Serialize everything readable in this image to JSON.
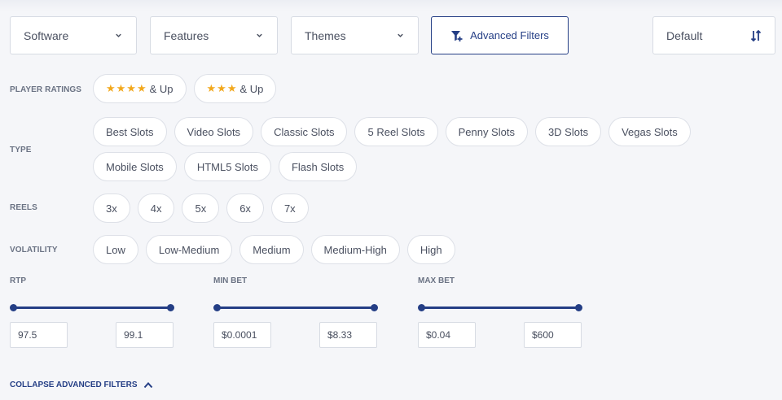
{
  "dropdowns": {
    "software": "Software",
    "features": "Features",
    "themes": "Themes"
  },
  "advanced_filters_label": "Advanced Filters",
  "sort": {
    "value": "Default",
    "icon": "sort-arrows-icon"
  },
  "filters": {
    "player_ratings": {
      "label": "PLAYER RATINGS",
      "options": [
        {
          "stars": "★★★★",
          "text": "& Up"
        },
        {
          "stars": "★★★",
          "text": "& Up"
        }
      ]
    },
    "type": {
      "label": "TYPE",
      "options_row1": [
        "Best Slots",
        "Video Slots",
        "Classic Slots",
        "5 Reel Slots",
        "Penny Slots",
        "3D Slots",
        "Vegas Slots"
      ],
      "options_row2": [
        "Mobile Slots",
        "HTML5 Slots",
        "Flash Slots"
      ]
    },
    "reels": {
      "label": "REELS",
      "options": [
        "3x",
        "4x",
        "5x",
        "6x",
        "7x"
      ]
    },
    "volatility": {
      "label": "VOLATILITY",
      "options": [
        "Low",
        "Low-Medium",
        "Medium",
        "Medium-High",
        "High"
      ]
    }
  },
  "ranges": {
    "rtp": {
      "label": "RTP",
      "min": "97.5",
      "max": "99.1"
    },
    "min_bet": {
      "label": "MIN BET",
      "min": "$0.0001",
      "max": "$8.33"
    },
    "max_bet": {
      "label": "MAX BET",
      "min": "$0.04",
      "max": "$600"
    }
  },
  "collapse_label": "COLLAPSE ADVANCED FILTERS",
  "colors": {
    "accent": "#243e85",
    "star": "#f2a81d",
    "background": "#f5f6f9"
  }
}
